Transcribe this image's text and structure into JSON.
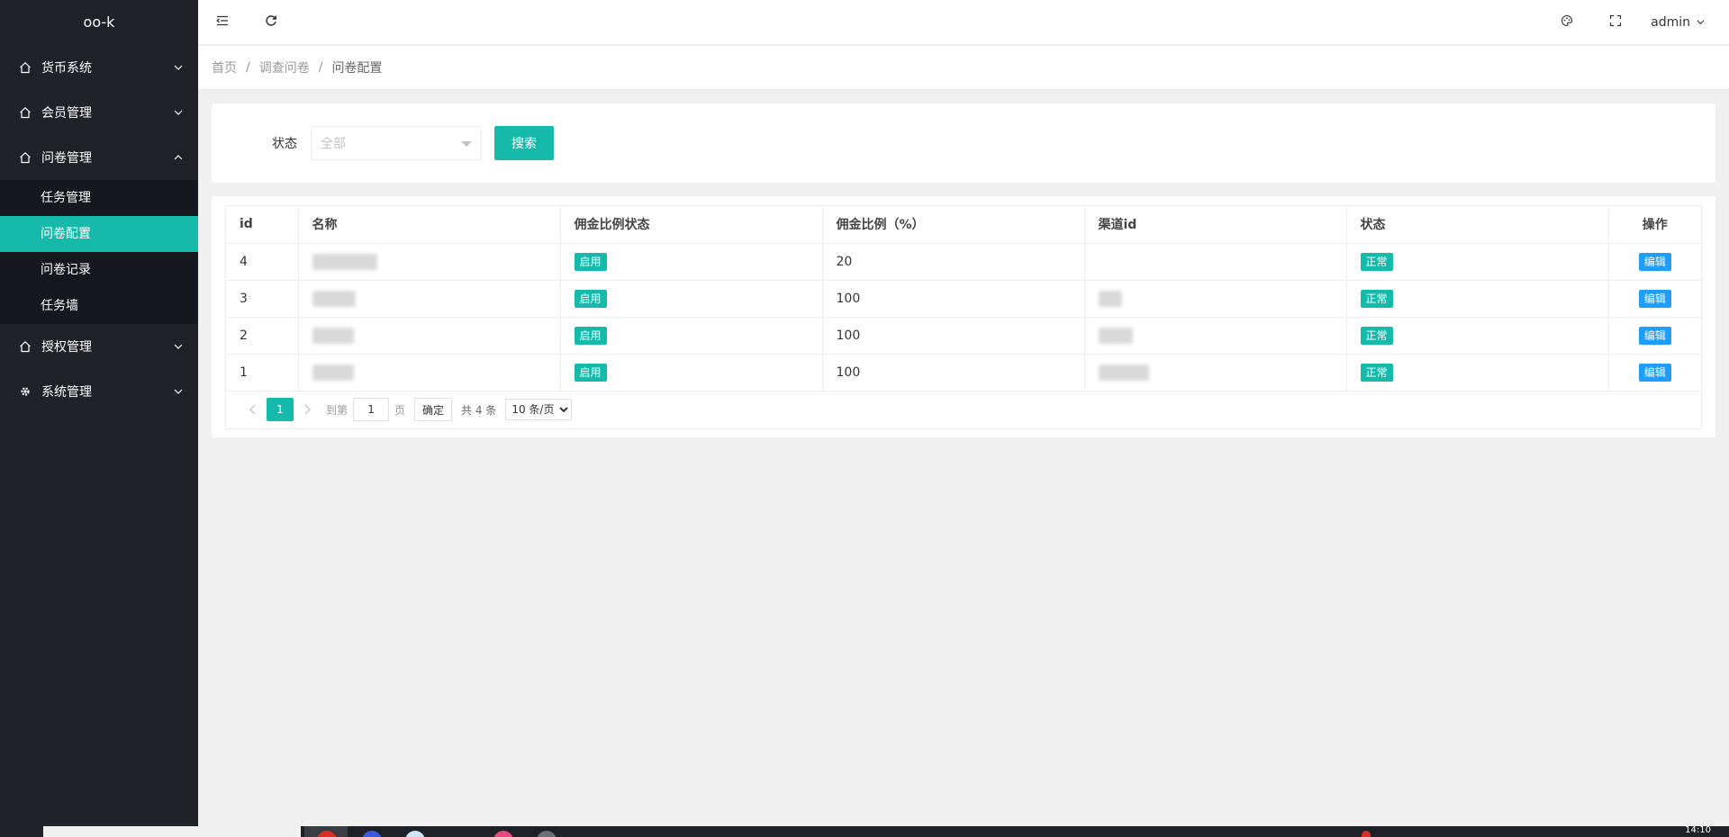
{
  "app": {
    "title": "oo-k"
  },
  "sidebar": {
    "items": [
      {
        "label": "货币系统",
        "icon": "home-icon",
        "expanded": false
      },
      {
        "label": "会员管理",
        "icon": "home-icon",
        "expanded": false
      },
      {
        "label": "问卷管理",
        "icon": "home-icon",
        "expanded": true,
        "children": [
          {
            "label": "任务管理",
            "active": false
          },
          {
            "label": "问卷配置",
            "active": true
          },
          {
            "label": "问卷记录",
            "active": false
          },
          {
            "label": "任务墙",
            "active": false
          }
        ]
      },
      {
        "label": "授权管理",
        "icon": "home-icon",
        "expanded": false
      },
      {
        "label": "系统管理",
        "icon": "gear-icon",
        "expanded": false
      }
    ]
  },
  "header": {
    "user": "admin",
    "icons": [
      "menu-toggle-icon",
      "refresh-icon",
      "theme-icon",
      "fullscreen-icon"
    ]
  },
  "breadcrumb": [
    "首页",
    "调查问卷",
    "问卷配置"
  ],
  "filter": {
    "status_label": "状态",
    "status_placeholder": "全部",
    "search_button": "搜索"
  },
  "table": {
    "columns": [
      "id",
      "名称",
      "佣金比例状态",
      "佣金比例（%）",
      "渠道id",
      "状态",
      "操作"
    ],
    "rows": [
      {
        "id": "4",
        "commission_status": "启用",
        "ratio": "20",
        "status": "正常",
        "action": "编辑"
      },
      {
        "id": "3",
        "commission_status": "启用",
        "ratio": "100",
        "status": "正常",
        "action": "编辑"
      },
      {
        "id": "2",
        "commission_status": "启用",
        "ratio": "100",
        "status": "正常",
        "action": "编辑"
      },
      {
        "id": "1",
        "commission_status": "启用",
        "ratio": "100",
        "status": "正常",
        "action": "编辑"
      }
    ]
  },
  "pagination": {
    "current_page": "1",
    "goto_label": "到第",
    "goto_value": "1",
    "page_unit": "页",
    "confirm": "确定",
    "total": "共 4 条",
    "page_size": "10 条/页"
  },
  "colors": {
    "sidebar_bg": "#20222a",
    "accent": "#16baaa",
    "edit_button": "#1e9fff"
  },
  "taskbar": {
    "time": "14:10"
  }
}
